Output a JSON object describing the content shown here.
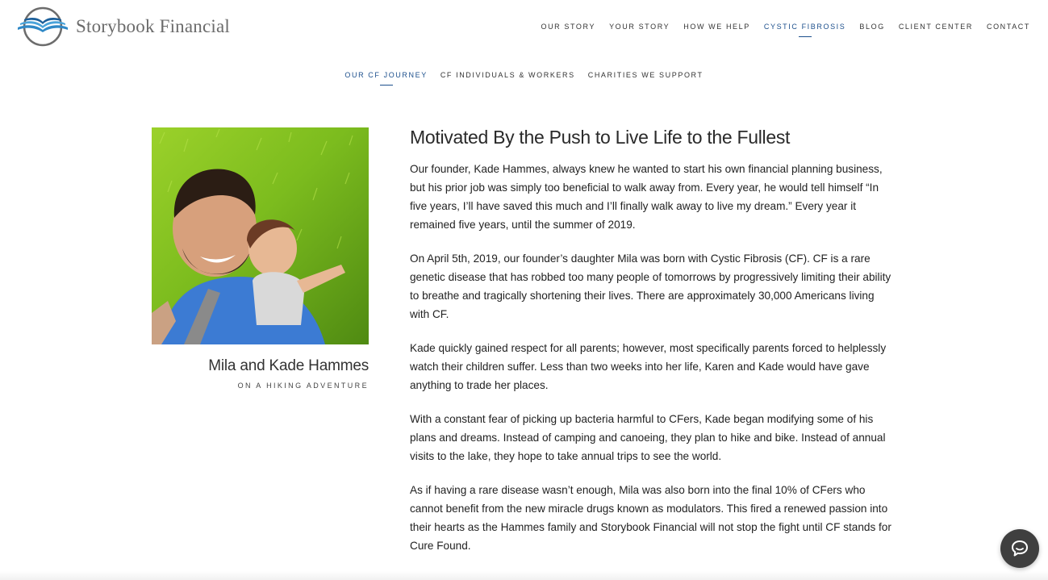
{
  "brand": {
    "name": "Storybook Financial"
  },
  "main_nav": [
    {
      "label": "OUR STORY",
      "active": false
    },
    {
      "label": "YOUR STORY",
      "active": false
    },
    {
      "label": "HOW WE HELP",
      "active": false
    },
    {
      "label": "CYSTIC FIBROSIS",
      "active": true
    },
    {
      "label": "BLOG",
      "active": false
    },
    {
      "label": "CLIENT CENTER",
      "active": false
    },
    {
      "label": "CONTACT",
      "active": false
    }
  ],
  "sub_nav": [
    {
      "label": "OUR CF JOURNEY",
      "active": true
    },
    {
      "label": "CF INDIVIDUALS & WORKERS",
      "active": false
    },
    {
      "label": "CHARITIES WE SUPPORT",
      "active": false
    }
  ],
  "photo_caption": {
    "name": "Mila and Kade Hammes",
    "subtitle": "ON A HIKING ADVENTURE"
  },
  "article": {
    "title": "Motivated By the Push to Live Life to the Fullest",
    "paragraphs": [
      "Our founder, Kade Hammes, always knew he wanted to start his own financial planning business, but his prior job was simply too beneficial to walk away from. Every year, he would tell himself “In five years, I’ll have saved this much and I’ll finally walk away to live my dream.” Every year it remained five years, until the summer of 2019.",
      "On April 5th, 2019, our founder’s daughter Mila was born with Cystic Fibrosis (CF). CF is a rare genetic disease that has robbed too many people of tomorrows by progressively limiting their ability to breathe and tragically shortening their lives. There are approximately 30,000 Americans living with CF.",
      "Kade quickly gained respect for all parents; however, most specifically parents forced to helplessly watch their children suffer. Less than two weeks into her life, Karen and Kade would have gave anything to trade her places.",
      "With a constant fear of picking up bacteria harmful to CFers, Kade began modifying some of his plans and dreams. Instead of camping and canoeing, they plan to hike and bike. Instead of annual visits to the lake, they hope to take annual trips to see the world.",
      "As if having a rare disease wasn’t enough, Mila was also born into the final 10% of CFers who cannot benefit from the new miracle drugs known as modulators. This fired a renewed passion into their hearts as the Hammes family and Storybook Financial will not stop the fight until CF stands for Cure Found."
    ]
  },
  "colors": {
    "accent": "#1c4f8c",
    "chat_button": "#3f3f3f"
  },
  "icons": {
    "logo": "open-book-globe-logo",
    "chat": "chat-bubble-icon"
  }
}
